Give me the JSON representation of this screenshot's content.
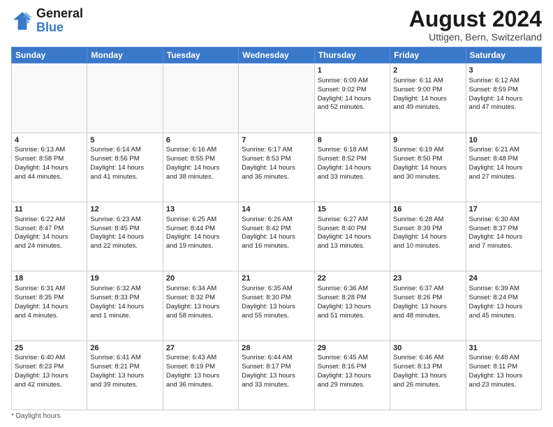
{
  "logo": {
    "text_general": "General",
    "text_blue": "Blue"
  },
  "header": {
    "month_title": "August 2024",
    "subtitle": "Uttigen, Bern, Switzerland"
  },
  "days_of_week": [
    "Sunday",
    "Monday",
    "Tuesday",
    "Wednesday",
    "Thursday",
    "Friday",
    "Saturday"
  ],
  "legend_label": "Daylight hours",
  "weeks": [
    {
      "days": [
        {
          "num": "",
          "info": ""
        },
        {
          "num": "",
          "info": ""
        },
        {
          "num": "",
          "info": ""
        },
        {
          "num": "",
          "info": ""
        },
        {
          "num": "1",
          "info": "Sunrise: 6:09 AM\nSunset: 9:02 PM\nDaylight: 14 hours\nand 52 minutes."
        },
        {
          "num": "2",
          "info": "Sunrise: 6:11 AM\nSunset: 9:00 PM\nDaylight: 14 hours\nand 49 minutes."
        },
        {
          "num": "3",
          "info": "Sunrise: 6:12 AM\nSunset: 8:59 PM\nDaylight: 14 hours\nand 47 minutes."
        }
      ]
    },
    {
      "days": [
        {
          "num": "4",
          "info": "Sunrise: 6:13 AM\nSunset: 8:58 PM\nDaylight: 14 hours\nand 44 minutes."
        },
        {
          "num": "5",
          "info": "Sunrise: 6:14 AM\nSunset: 8:56 PM\nDaylight: 14 hours\nand 41 minutes."
        },
        {
          "num": "6",
          "info": "Sunrise: 6:16 AM\nSunset: 8:55 PM\nDaylight: 14 hours\nand 38 minutes."
        },
        {
          "num": "7",
          "info": "Sunrise: 6:17 AM\nSunset: 8:53 PM\nDaylight: 14 hours\nand 36 minutes."
        },
        {
          "num": "8",
          "info": "Sunrise: 6:18 AM\nSunset: 8:52 PM\nDaylight: 14 hours\nand 33 minutes."
        },
        {
          "num": "9",
          "info": "Sunrise: 6:19 AM\nSunset: 8:50 PM\nDaylight: 14 hours\nand 30 minutes."
        },
        {
          "num": "10",
          "info": "Sunrise: 6:21 AM\nSunset: 8:48 PM\nDaylight: 14 hours\nand 27 minutes."
        }
      ]
    },
    {
      "days": [
        {
          "num": "11",
          "info": "Sunrise: 6:22 AM\nSunset: 8:47 PM\nDaylight: 14 hours\nand 24 minutes."
        },
        {
          "num": "12",
          "info": "Sunrise: 6:23 AM\nSunset: 8:45 PM\nDaylight: 14 hours\nand 22 minutes."
        },
        {
          "num": "13",
          "info": "Sunrise: 6:25 AM\nSunset: 8:44 PM\nDaylight: 14 hours\nand 19 minutes."
        },
        {
          "num": "14",
          "info": "Sunrise: 6:26 AM\nSunset: 8:42 PM\nDaylight: 14 hours\nand 16 minutes."
        },
        {
          "num": "15",
          "info": "Sunrise: 6:27 AM\nSunset: 8:40 PM\nDaylight: 14 hours\nand 13 minutes."
        },
        {
          "num": "16",
          "info": "Sunrise: 6:28 AM\nSunset: 8:39 PM\nDaylight: 14 hours\nand 10 minutes."
        },
        {
          "num": "17",
          "info": "Sunrise: 6:30 AM\nSunset: 8:37 PM\nDaylight: 14 hours\nand 7 minutes."
        }
      ]
    },
    {
      "days": [
        {
          "num": "18",
          "info": "Sunrise: 6:31 AM\nSunset: 8:35 PM\nDaylight: 14 hours\nand 4 minutes."
        },
        {
          "num": "19",
          "info": "Sunrise: 6:32 AM\nSunset: 8:33 PM\nDaylight: 14 hours\nand 1 minute."
        },
        {
          "num": "20",
          "info": "Sunrise: 6:34 AM\nSunset: 8:32 PM\nDaylight: 13 hours\nand 58 minutes."
        },
        {
          "num": "21",
          "info": "Sunrise: 6:35 AM\nSunset: 8:30 PM\nDaylight: 13 hours\nand 55 minutes."
        },
        {
          "num": "22",
          "info": "Sunrise: 6:36 AM\nSunset: 8:28 PM\nDaylight: 13 hours\nand 51 minutes."
        },
        {
          "num": "23",
          "info": "Sunrise: 6:37 AM\nSunset: 8:26 PM\nDaylight: 13 hours\nand 48 minutes."
        },
        {
          "num": "24",
          "info": "Sunrise: 6:39 AM\nSunset: 8:24 PM\nDaylight: 13 hours\nand 45 minutes."
        }
      ]
    },
    {
      "days": [
        {
          "num": "25",
          "info": "Sunrise: 6:40 AM\nSunset: 8:23 PM\nDaylight: 13 hours\nand 42 minutes."
        },
        {
          "num": "26",
          "info": "Sunrise: 6:41 AM\nSunset: 8:21 PM\nDaylight: 13 hours\nand 39 minutes."
        },
        {
          "num": "27",
          "info": "Sunrise: 6:43 AM\nSunset: 8:19 PM\nDaylight: 13 hours\nand 36 minutes."
        },
        {
          "num": "28",
          "info": "Sunrise: 6:44 AM\nSunset: 8:17 PM\nDaylight: 13 hours\nand 33 minutes."
        },
        {
          "num": "29",
          "info": "Sunrise: 6:45 AM\nSunset: 8:15 PM\nDaylight: 13 hours\nand 29 minutes."
        },
        {
          "num": "30",
          "info": "Sunrise: 6:46 AM\nSunset: 8:13 PM\nDaylight: 13 hours\nand 26 minutes."
        },
        {
          "num": "31",
          "info": "Sunrise: 6:48 AM\nSunset: 8:11 PM\nDaylight: 13 hours\nand 23 minutes."
        }
      ]
    }
  ]
}
